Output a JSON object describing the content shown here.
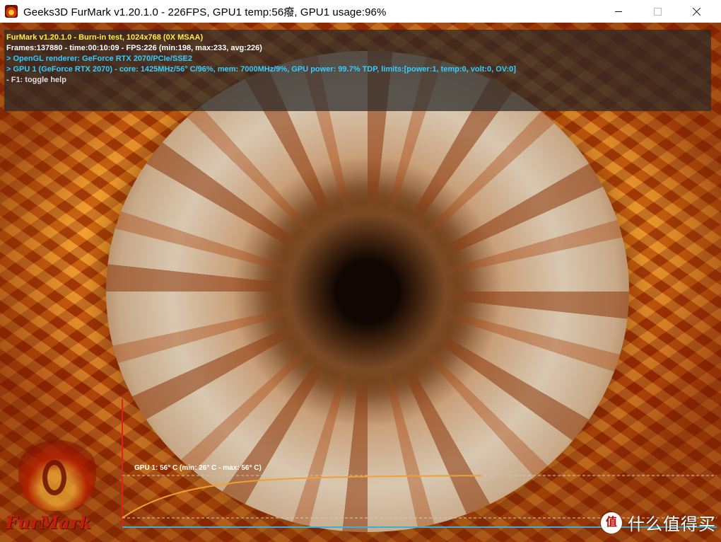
{
  "window": {
    "title": "Geeks3D FurMark v1.20.1.0 - 226FPS, GPU1 temp:56癈, GPU1 usage:96%"
  },
  "hud": {
    "line1": "FurMark v1.20.1.0 - Burn-in test, 1024x768 (0X MSAA)",
    "line2": "Frames:137880 - time:00:10:09 - FPS:226 (min:198, max:233, avg:226)",
    "line3": "> OpenGL renderer: GeForce RTX 2070/PCIe/SSE2",
    "line4": "> GPU 1 (GeForce RTX 2070) - core: 1425MHz/56° C/96%, mem: 7000MHz/9%, GPU power: 99.7% TDP, limits:[power:1, temp:0, volt:0, OV:0]",
    "line5": "- F1: toggle help"
  },
  "logo": {
    "text": "FurMark"
  },
  "temp_graph": {
    "label": "GPU 1: 56° C (min: 26° C - max: 56° C)",
    "min_c": 26,
    "max_c": 56,
    "current_c": 56,
    "line_color": "#f0a030",
    "axis_color": "#e02020",
    "baseline_color": "#3ab0d8"
  },
  "watermark": {
    "text": "什么值得买"
  }
}
